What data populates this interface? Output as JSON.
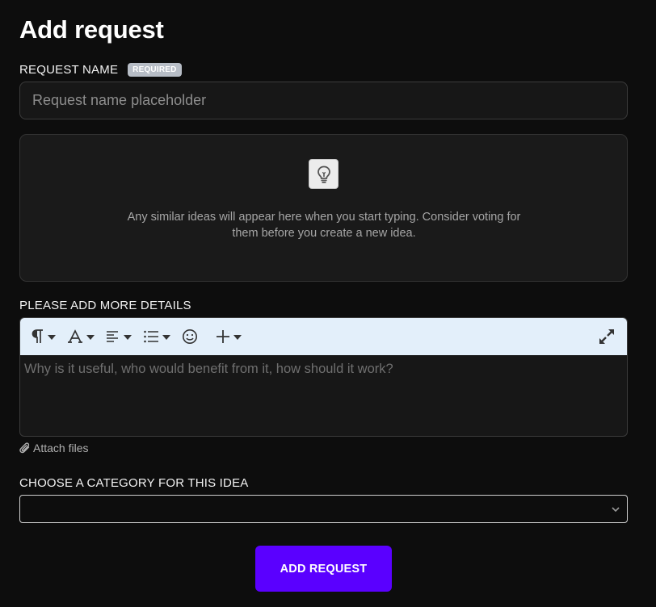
{
  "form": {
    "title": "Add request",
    "request_name": {
      "label": "REQUEST NAME",
      "badge": "REQUIRED",
      "placeholder": "Request name placeholder",
      "value": ""
    },
    "similar_ideas": {
      "icon": "lightbulb-icon",
      "message": "Any similar ideas will appear here when you start typing. Consider voting for them before you create a new idea."
    },
    "details": {
      "label": "PLEASE ADD MORE DETAILS",
      "toolbar": [
        {
          "name": "paragraph-format",
          "icon": "pilcrow-icon"
        },
        {
          "name": "text-format",
          "icon": "font-icon"
        },
        {
          "name": "align",
          "icon": "align-left-icon"
        },
        {
          "name": "list",
          "icon": "list-icon"
        },
        {
          "name": "emoji",
          "icon": "smiley-icon"
        },
        {
          "name": "insert",
          "icon": "plus-icon"
        },
        {
          "name": "fullscreen",
          "icon": "expand-icon"
        }
      ],
      "placeholder": "Why is it useful, who would benefit from it, how should it work?"
    },
    "attach_label": "Attach files",
    "category": {
      "label": "CHOOSE A CATEGORY FOR THIS IDEA",
      "selected": ""
    },
    "submit_label": "ADD REQUEST"
  },
  "colors": {
    "background": "#0d0d0d",
    "accent": "#5a00ff",
    "toolbar": "#e3effa",
    "badge": "#b7bdc6"
  }
}
